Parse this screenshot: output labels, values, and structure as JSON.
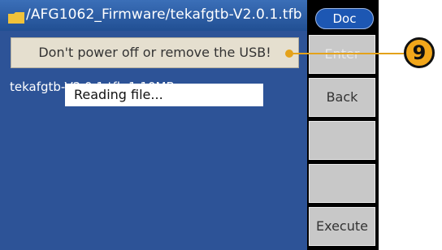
{
  "title_bar": {
    "icon": "folder-icon",
    "path": "/AFG1062_Firmware/tekafgtb-V2.0.1.tfb",
    "doc_label": "Doc"
  },
  "warning_message": "Don't power off or remove the USB!",
  "file_list": {
    "entry_text": "tekafgtb-V2.0.1.tfb      1.10MB"
  },
  "popup": {
    "text": "Reading file..."
  },
  "softkeys": [
    {
      "label": "Enter",
      "enabled": false
    },
    {
      "label": "Back",
      "enabled": true
    },
    {
      "label": "",
      "enabled": true
    },
    {
      "label": "",
      "enabled": true
    },
    {
      "label": "Execute",
      "enabled": true
    }
  ],
  "callout": {
    "number": "9",
    "color": "#f2a71b"
  }
}
